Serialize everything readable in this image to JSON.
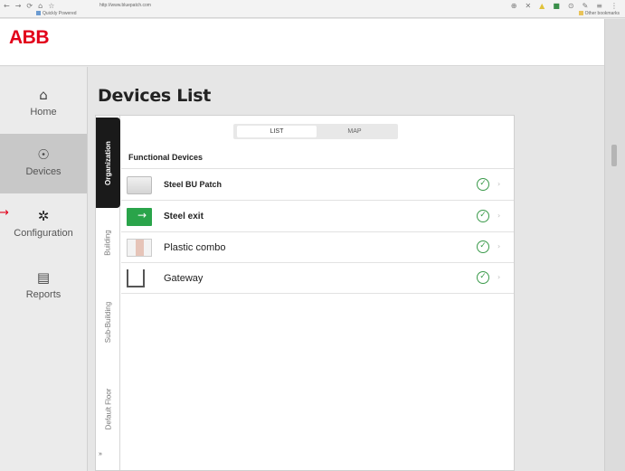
{
  "browser": {
    "nav_icons": [
      "←",
      "→",
      "⟳",
      "⌂",
      "☆"
    ],
    "url": "http://www.bluepatch.com",
    "bookmark": "Quickly Powered",
    "other_bookmarks": "Other bookmarks",
    "toolbar_icons": [
      "⊕",
      "✕",
      "▲",
      "■",
      "⊙",
      "✎",
      "≡",
      "⋮"
    ]
  },
  "header": {
    "logo": "ABB"
  },
  "sidebar": {
    "items": [
      {
        "label": "Home",
        "icon": "home-icon",
        "glyph": "⌂"
      },
      {
        "label": "Devices",
        "icon": "lightbulb-icon",
        "glyph": "☉"
      },
      {
        "label": "Configuration",
        "icon": "gear-icon",
        "glyph": "✲"
      },
      {
        "label": "Reports",
        "icon": "document-icon",
        "glyph": "▤"
      }
    ],
    "active": "Devices"
  },
  "pointer_arrow": "→",
  "main": {
    "title": "Devices List",
    "view_toggle": {
      "list": "LIST",
      "map": "MAP",
      "selected": "LIST"
    },
    "vertical_tabs": [
      "Organization",
      "Building",
      "Sub-Building",
      "Default Floor"
    ],
    "active_tab": "Organization",
    "collapse_glyph": "»",
    "section_title": "Functional Devices",
    "devices": [
      {
        "name": "Steel BU Patch",
        "status_glyph": "✓",
        "more_glyph": "›"
      },
      {
        "name": "Steel exit",
        "status_glyph": "✓",
        "more_glyph": "›"
      },
      {
        "name": "Plastic combo",
        "status_glyph": "✓",
        "more_glyph": "›"
      },
      {
        "name": "Gateway",
        "status_glyph": "✓",
        "more_glyph": "›"
      }
    ]
  },
  "colors": {
    "brand": "#e2001a",
    "status_ok": "#3a9a4a",
    "active_tab": "#1a1a1a"
  }
}
